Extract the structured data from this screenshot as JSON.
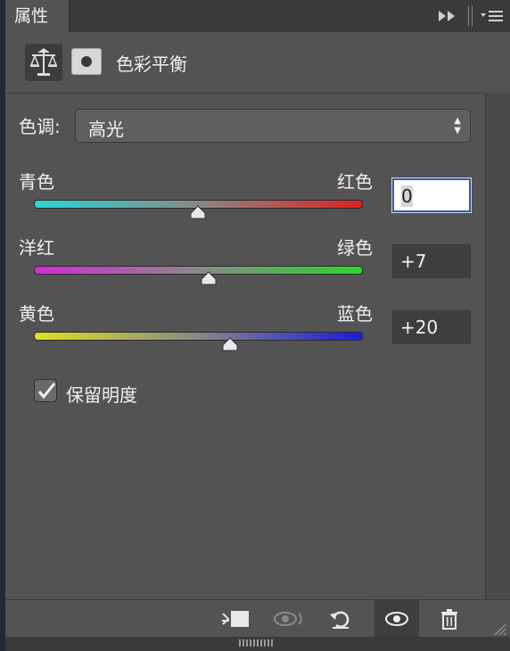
{
  "panel": {
    "tab_label": "属性",
    "adjustment_title": "色彩平衡"
  },
  "tone": {
    "label": "色调:",
    "selected": "高光"
  },
  "sliders": [
    {
      "left_label": "青色",
      "right_label": "红色",
      "value": "0",
      "numeric": 0,
      "gradient": [
        "#29d6d6",
        "#e02020"
      ]
    },
    {
      "left_label": "洋红",
      "right_label": "绿色",
      "value": "+7",
      "numeric": 7,
      "gradient": [
        "#d62ad6",
        "#2ad62a"
      ]
    },
    {
      "left_label": "黄色",
      "right_label": "蓝色",
      "value": "+20",
      "numeric": 20,
      "gradient": [
        "#e0e020",
        "#1a1ae0"
      ]
    }
  ],
  "preserve_luminosity": {
    "label": "保留明度",
    "checked": true
  },
  "footer_icons": [
    "clip-to-layer-icon",
    "view-previous-icon",
    "reset-icon",
    "visibility-eye-icon",
    "trash-icon"
  ],
  "colors": {
    "panel_bg": "#535353",
    "active_input_border": "#2f5e9e"
  }
}
